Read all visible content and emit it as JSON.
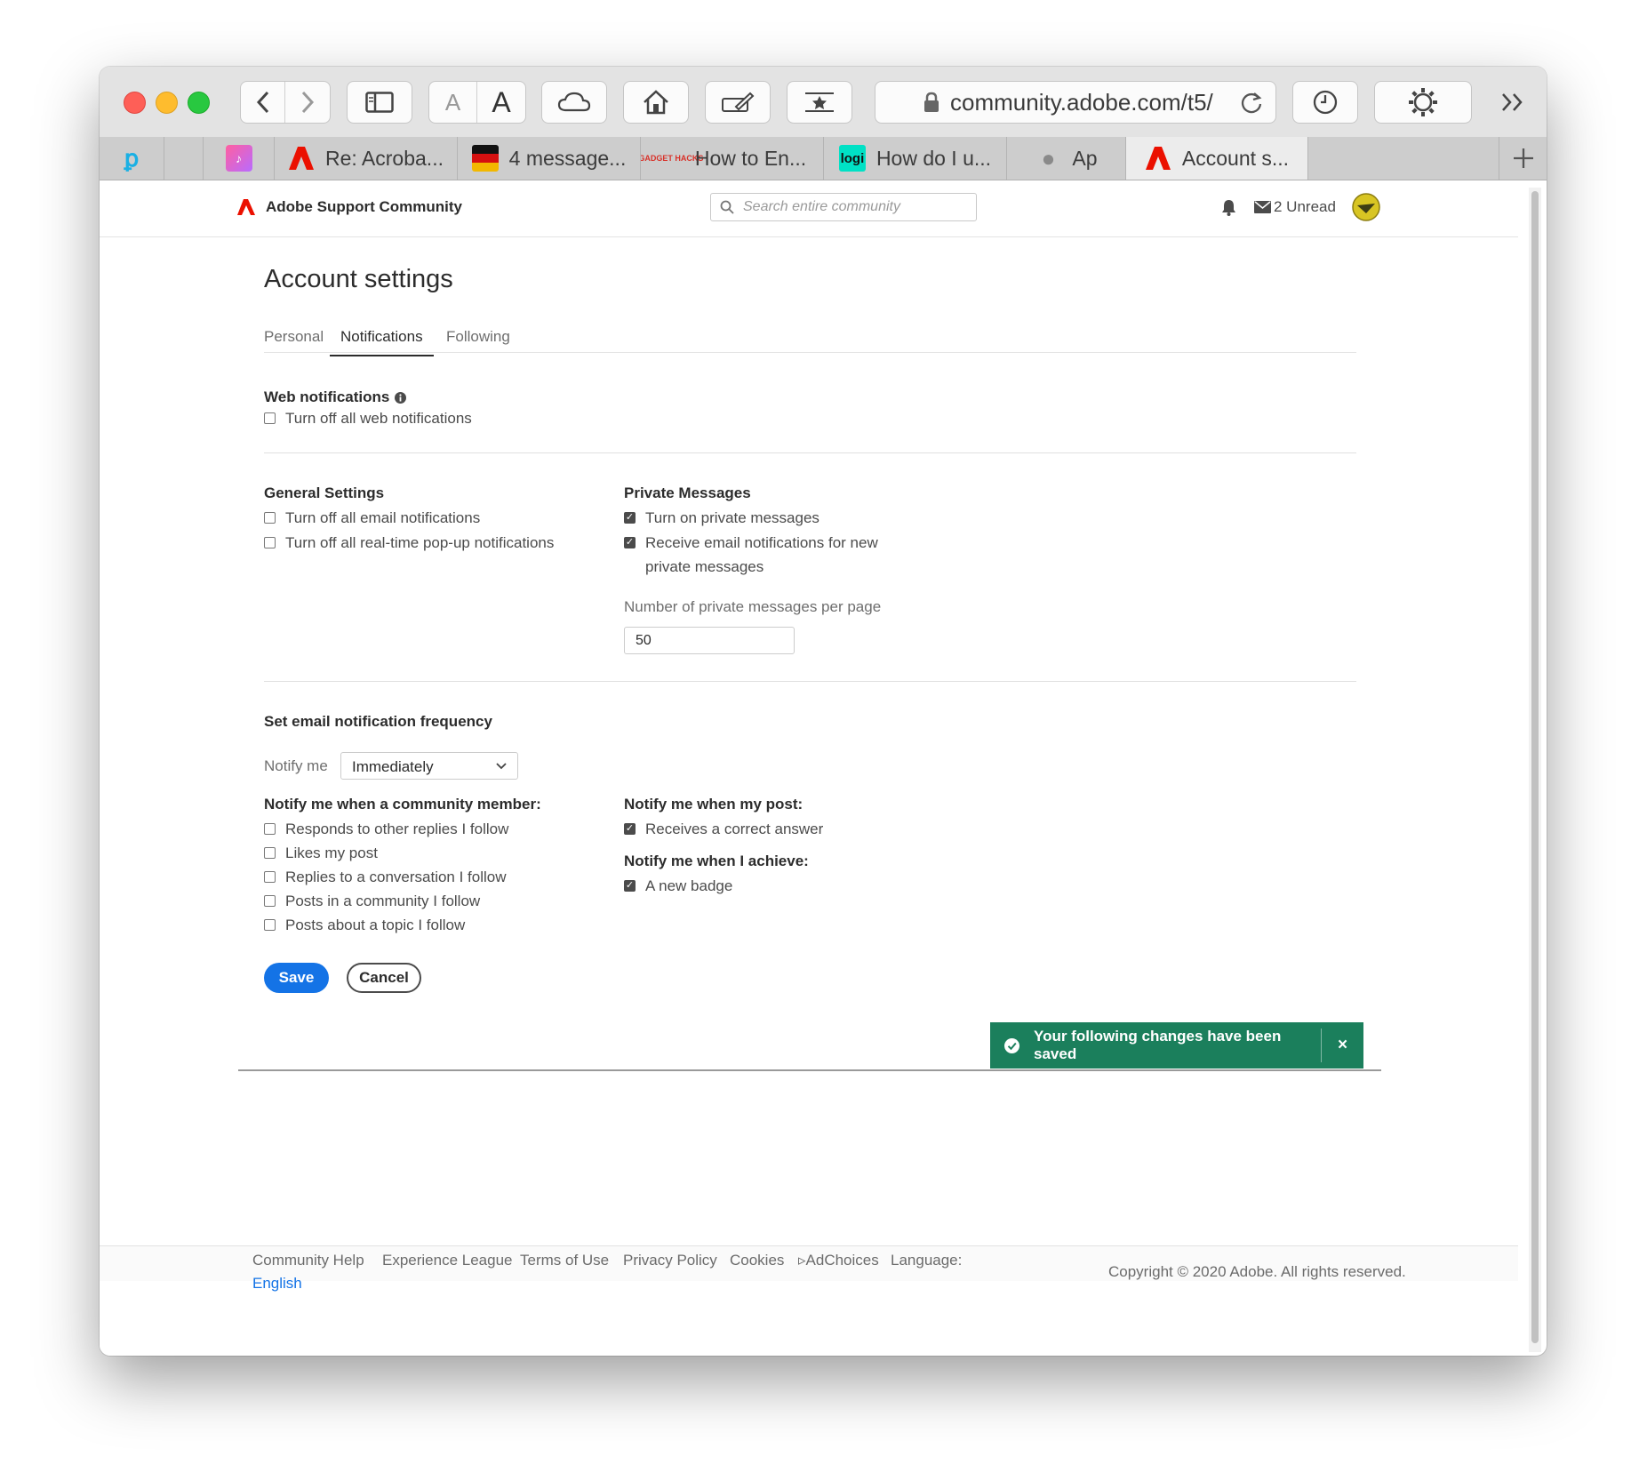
{
  "browser": {
    "address": "community.adobe.com/t5/",
    "tabs": [
      "",
      "",
      "Re: Acroba...",
      "4 message...",
      "How to En...",
      "How do I u...",
      "Ap",
      "Account s..."
    ]
  },
  "header": {
    "site_name": "Adobe Support Community",
    "search_placeholder": "Search entire community",
    "unread": "2 Unread"
  },
  "page": {
    "title": "Account settings",
    "tabs": [
      "Personal",
      "Notifications",
      "Following"
    ]
  },
  "web_notifications": {
    "heading": "Web notifications",
    "option": "Turn off all web notifications"
  },
  "general": {
    "heading": "General Settings",
    "options": [
      "Turn off all email notifications",
      "Turn off all real-time pop-up notifications"
    ]
  },
  "private": {
    "heading": "Private Messages",
    "options": [
      "Turn on private messages",
      "Receive email notifications for new private messages"
    ],
    "per_page_label": "Number of private messages per page",
    "per_page_value": "50"
  },
  "frequency": {
    "heading": "Set email notification frequency",
    "notify_label": "Notify me",
    "notify_value": "Immediately"
  },
  "member": {
    "heading": "Notify me when a community member:",
    "options": [
      "Responds to other replies I follow",
      "Likes my post",
      "Replies to a conversation I follow",
      "Posts in a community I follow",
      "Posts about a topic I follow"
    ]
  },
  "post": {
    "heading": "Notify me when my post:",
    "options": [
      "Receives a correct answer"
    ]
  },
  "achieve": {
    "heading": "Notify me when I achieve:",
    "options": [
      "A new badge"
    ]
  },
  "buttons": {
    "save": "Save",
    "cancel": "Cancel"
  },
  "toast": {
    "message": "Your following changes have been saved",
    "close": "×"
  },
  "footer": {
    "links": [
      "Community Help",
      "Experience League",
      "Terms of Use",
      "Privacy Policy",
      "Cookies",
      "▹AdChoices",
      "Language:"
    ],
    "language": "English",
    "copyright": "Copyright © 2020 Adobe. All rights reserved."
  },
  "colors": {
    "save_blue": "#1473e6",
    "toast_green": "#1b7f5c",
    "adobe_red": "#eb1000"
  }
}
